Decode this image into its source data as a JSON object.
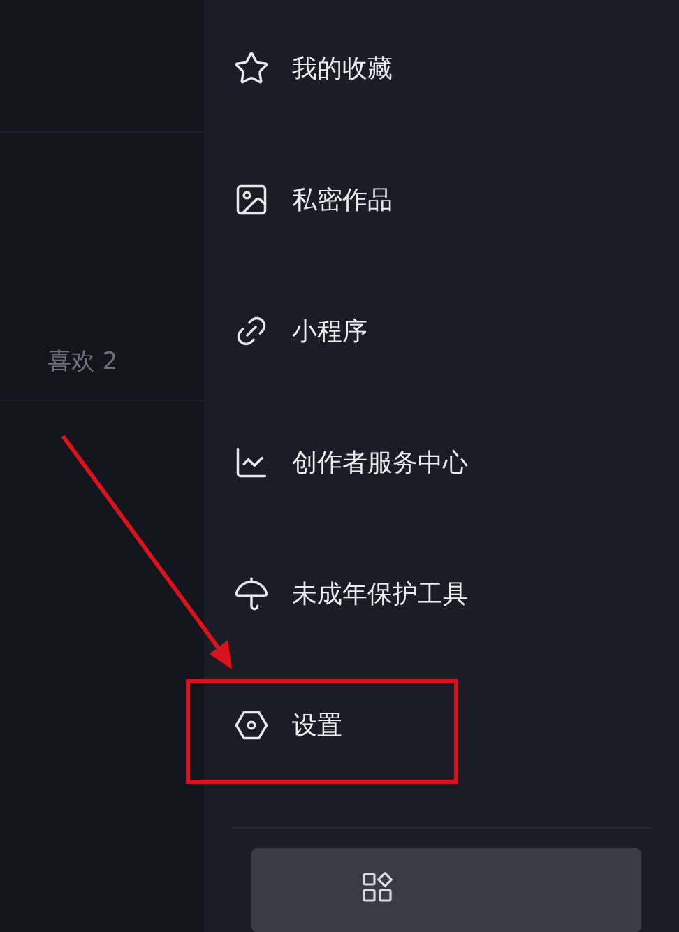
{
  "left_panel": {
    "likes_tab": "喜欢 2"
  },
  "menu": [
    {
      "kind": "star",
      "label": "我的收藏"
    },
    {
      "kind": "image",
      "label": "私密作品"
    },
    {
      "kind": "link",
      "label": "小程序"
    },
    {
      "kind": "chart",
      "label": "创作者服务中心"
    },
    {
      "kind": "umbrella",
      "label": "未成年保护工具"
    },
    {
      "kind": "settings",
      "label": "设置",
      "highlighted": true
    }
  ],
  "bottom_button": {
    "kind": "apps"
  }
}
